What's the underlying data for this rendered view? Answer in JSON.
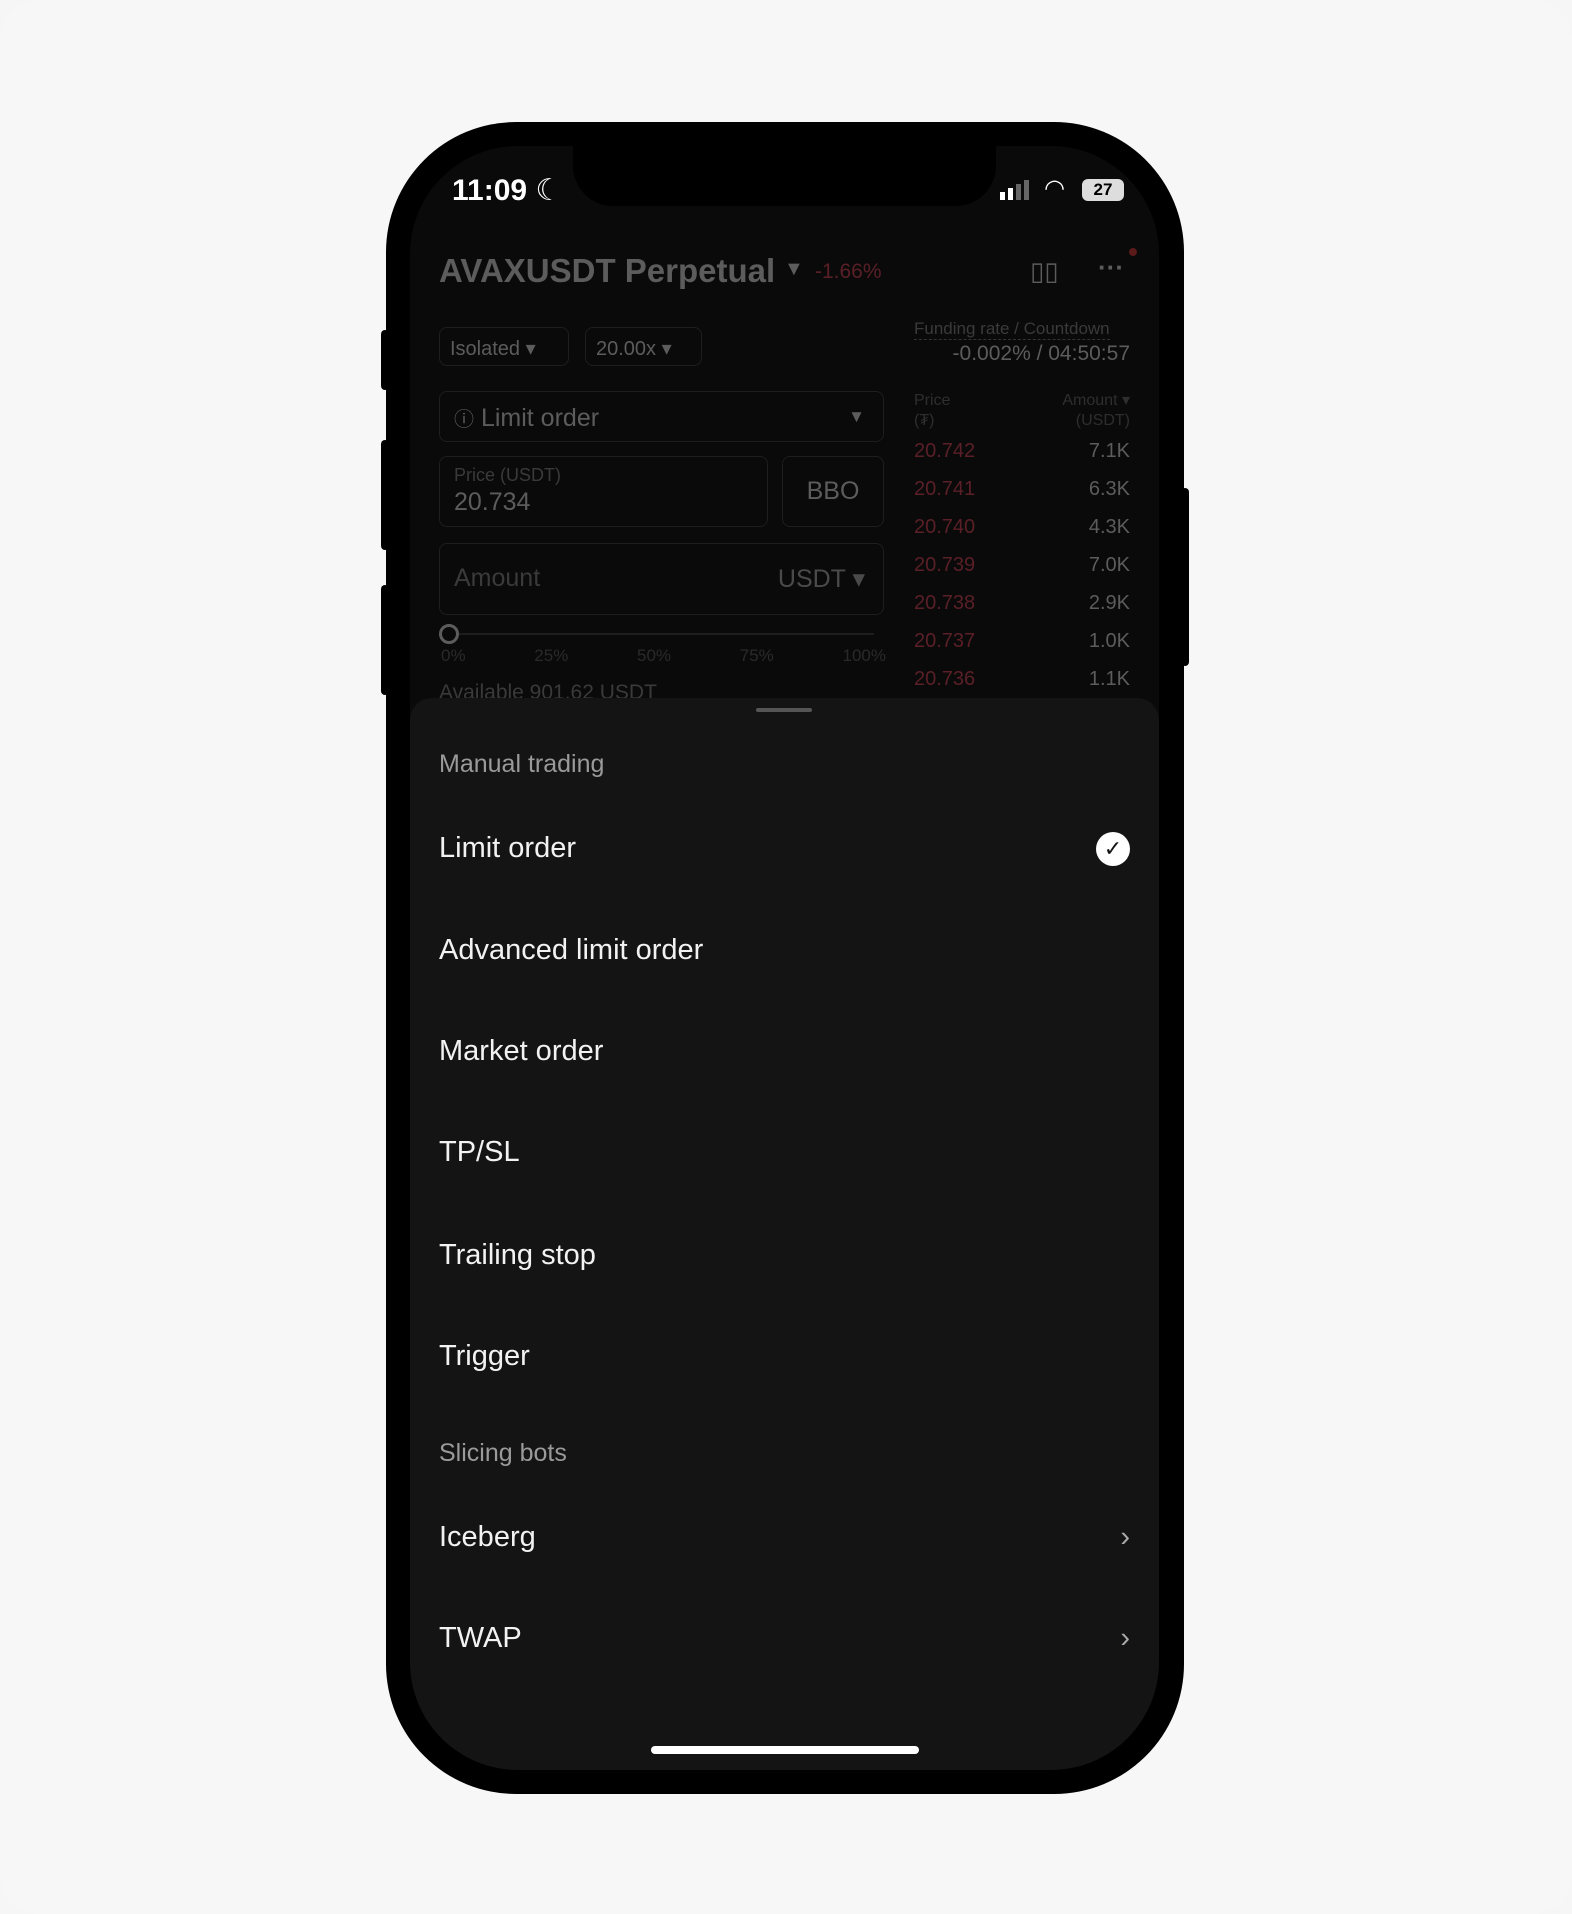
{
  "status": {
    "time": "11:09",
    "battery": "27"
  },
  "header": {
    "title": "AVAXUSDT Perpetual",
    "change": "-1.66%"
  },
  "controls": {
    "margin_mode": "Isolated",
    "leverage": "20.00x",
    "order_type": "Limit order",
    "price_label": "Price (USDT)",
    "price_value": "20.734",
    "bbo": "BBO",
    "amount_placeholder": "Amount",
    "amount_unit": "USDT",
    "slider": {
      "value_percent": 0,
      "marks": [
        "0%",
        "25%",
        "50%",
        "75%",
        "100%"
      ]
    },
    "available": "Available 901.62 USDT"
  },
  "funding": {
    "label": "Funding rate / Countdown",
    "value": "-0.002% / 04:50:57"
  },
  "orderbook": {
    "price_header": "Price",
    "price_unit": "(₮)",
    "amount_header": "Amount",
    "amount_unit": "(USDT)",
    "rows": [
      {
        "price": "20.742",
        "amount": "7.1K"
      },
      {
        "price": "20.741",
        "amount": "6.3K"
      },
      {
        "price": "20.740",
        "amount": "4.3K"
      },
      {
        "price": "20.739",
        "amount": "7.0K"
      },
      {
        "price": "20.738",
        "amount": "2.9K"
      },
      {
        "price": "20.737",
        "amount": "1.0K"
      },
      {
        "price": "20.736",
        "amount": "1.1K"
      }
    ]
  },
  "sheet": {
    "manual_label": "Manual trading",
    "manual_items": [
      "Limit order",
      "Advanced limit order",
      "Market order",
      "TP/SL",
      "Trailing stop",
      "Trigger"
    ],
    "selected": "Limit order",
    "bots_label": "Slicing bots",
    "bot_items": [
      "Iceberg",
      "TWAP"
    ]
  },
  "colors": {
    "sell": "#f0364f",
    "background": "#141414"
  }
}
